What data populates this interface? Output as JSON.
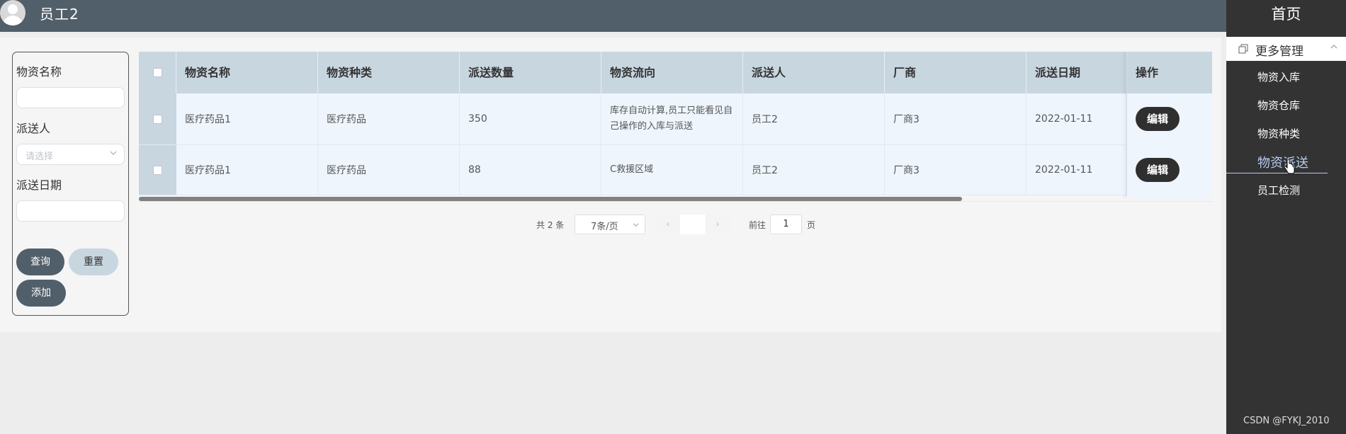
{
  "header": {
    "username": "员工2"
  },
  "sidebar": {
    "home": "首页",
    "group": "更多管理",
    "items": [
      {
        "label": "物资入库",
        "active": false
      },
      {
        "label": "物资仓库",
        "active": false
      },
      {
        "label": "物资种类",
        "active": false
      },
      {
        "label": "物资派送",
        "active": true
      },
      {
        "label": "员工检测",
        "active": false
      }
    ],
    "footer": "CSDN @FYKJ_2010",
    "active_color": "#b6ccf2"
  },
  "filter": {
    "name_label": "物资名称",
    "name_value": "",
    "sender_label": "派送人",
    "sender_placeholder": "请选择",
    "date_label": "派送日期",
    "date_value": "",
    "query_label": "查询",
    "reset_label": "重置",
    "add_label": "添加"
  },
  "table": {
    "columns": [
      "物资名称",
      "物资种类",
      "派送数量",
      "物资流向",
      "派送人",
      "厂商",
      "派送日期",
      "操作"
    ],
    "rows": [
      {
        "name": "医疗药品1",
        "category": "医疗药品",
        "quantity": "350",
        "flow": "库存自动计算,员工只能看见自己操作的入库与派送",
        "sender": "员工2",
        "vendor": "厂商3",
        "date": "2022-01-11",
        "action": "编辑"
      },
      {
        "name": "医疗药品1",
        "category": "医疗药品",
        "quantity": "88",
        "flow": "C救援区域",
        "sender": "员工2",
        "vendor": "厂商3",
        "date": "2022-01-11",
        "action": "编辑"
      }
    ]
  },
  "pagination": {
    "total_text": "共 2 条",
    "page_size": "7条/页",
    "prev": "‹",
    "next": "›",
    "goto_label": "前往",
    "current_page": "1",
    "page_suffix": "页"
  },
  "colors": {
    "topbar": "#515f6a",
    "sidebar": "#333333",
    "table_header": "#c8d6e0",
    "row_bg": "#eef5fd",
    "edit_button": "#2f2f2f"
  },
  "icons": {
    "avatar": "user-avatar-icon",
    "group": "copy-icon",
    "group_arrow": "chevron-up-icon",
    "select_arrow": "chevron-down-icon",
    "cursor": "hand-pointer-icon"
  }
}
